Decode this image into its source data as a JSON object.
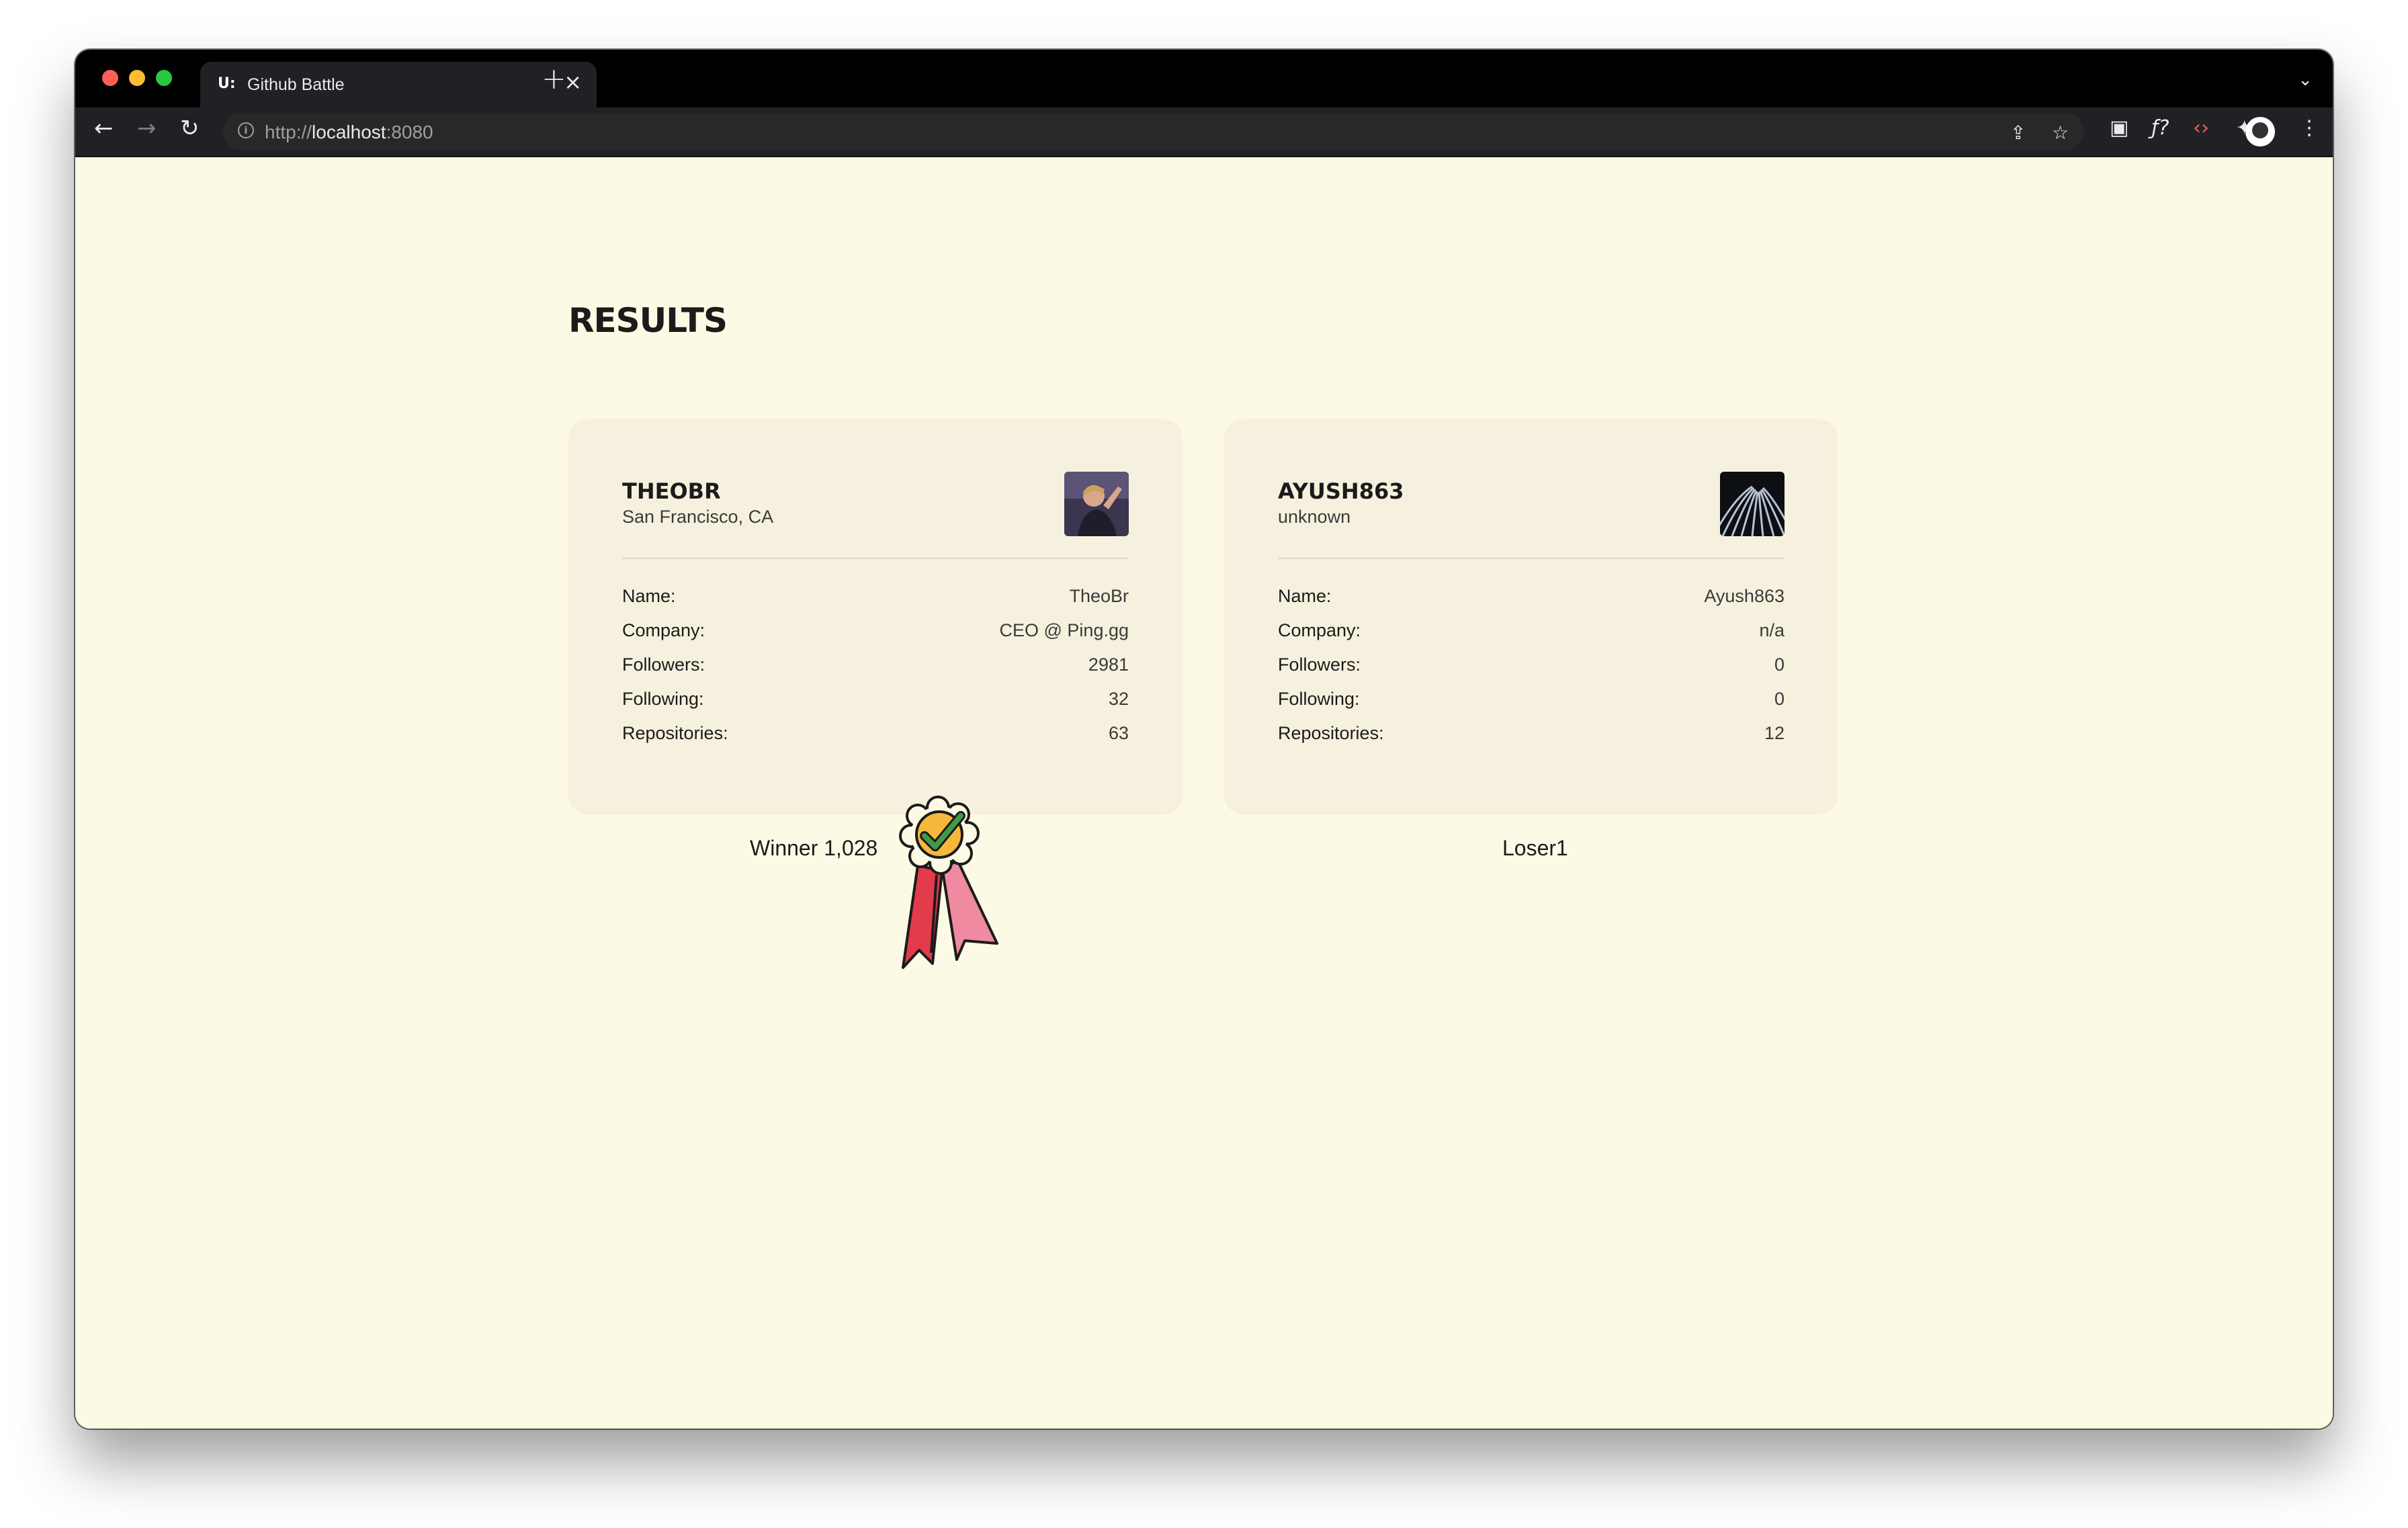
{
  "browser": {
    "tab_title": "Github Battle",
    "tab_favicon": "U:",
    "url_scheme": "http://",
    "url_host": "localhost",
    "url_port": ":8080"
  },
  "page": {
    "title": "RESULTS"
  },
  "players": [
    {
      "login": "THEOBR",
      "location": "San Francisco, CA",
      "avatar": "theobr-photo",
      "stats": [
        {
          "label": "Name:",
          "value": "TheoBr"
        },
        {
          "label": "Company:",
          "value": "CEO @ Ping.gg"
        },
        {
          "label": "Followers:",
          "value": "2981"
        },
        {
          "label": "Following:",
          "value": "32"
        },
        {
          "label": "Repositories:",
          "value": "63"
        }
      ],
      "result_label": "Winner 1,028"
    },
    {
      "login": "AYUSH863",
      "location": "unknown",
      "avatar": "ayush863-photo",
      "stats": [
        {
          "label": "Name:",
          "value": "Ayush863"
        },
        {
          "label": "Company:",
          "value": "n/a"
        },
        {
          "label": "Followers:",
          "value": "0"
        },
        {
          "label": "Following:",
          "value": "0"
        },
        {
          "label": "Repositories:",
          "value": "12"
        }
      ],
      "result_label": "Loser1"
    }
  ],
  "colors": {
    "page_background": "#fcf9e5",
    "card_background": "#f6f1de",
    "badge_gold": "#f5b83d",
    "badge_check": "#3f9a4a",
    "ribbon_red": "#e23b4a",
    "ribbon_pink": "#f08aa0"
  },
  "icons": [
    "back-arrow-icon",
    "forward-arrow-icon",
    "reload-icon",
    "info-icon",
    "share-icon",
    "star-icon",
    "notion-icon",
    "formula-icon",
    "code-icon",
    "puzzle-icon",
    "sidepanel-icon",
    "profile-icon",
    "more-icon",
    "winner-badge-icon"
  ]
}
